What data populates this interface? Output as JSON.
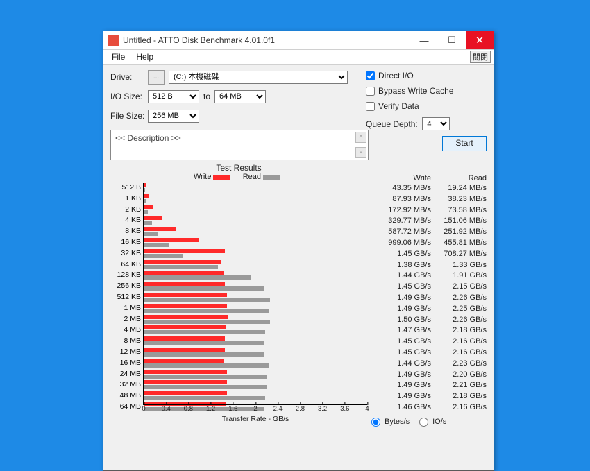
{
  "title": "Untitled - ATTO Disk Benchmark 4.01.0f1",
  "menu": {
    "file": "File",
    "help": "Help",
    "close_jp": "關閉"
  },
  "labels": {
    "drive": "Drive:",
    "iosize": "I/O Size:",
    "filesize": "File Size:",
    "to": "to",
    "testres": "Test Results",
    "write": "Write",
    "read": "Read",
    "xlabel": "Transfer Rate - GB/s",
    "desc": "<< Description >>",
    "dio": "Direct I/O",
    "bwc": "Bypass Write Cache",
    "vd": "Verify Data",
    "qd": "Queue Depth:",
    "start": "Start",
    "bytes": "Bytes/s",
    "ios": "IO/s",
    "browse": "..."
  },
  "values": {
    "drive": "(C:) 本機磁碟",
    "io_from": "512 B",
    "io_to": "64 MB",
    "filesize": "256 MB",
    "qd": "4"
  },
  "checkboxes": {
    "dio": true,
    "bwc": false,
    "vd": false
  },
  "radio": "bytes",
  "axis": {
    "max": 4,
    "ticks": [
      "0",
      "0.4",
      "0.8",
      "1.2",
      "1.6",
      "2",
      "2.4",
      "2.8",
      "3.2",
      "3.6",
      "4"
    ]
  },
  "chart_data": {
    "type": "bar",
    "orientation": "horizontal",
    "title": "Test Results",
    "xlabel": "Transfer Rate - GB/s",
    "xlim": [
      0,
      4
    ],
    "xticks": [
      0,
      0.4,
      0.8,
      1.2,
      1.6,
      2,
      2.4,
      2.8,
      3.2,
      3.6,
      4
    ],
    "categories": [
      "512 B",
      "1 KB",
      "2 KB",
      "4 KB",
      "8 KB",
      "16 KB",
      "32 KB",
      "64 KB",
      "128 KB",
      "256 KB",
      "512 KB",
      "1 MB",
      "2 MB",
      "4 MB",
      "8 MB",
      "12 MB",
      "16 MB",
      "24 MB",
      "32 MB",
      "48 MB",
      "64 MB"
    ],
    "series": [
      {
        "name": "Write",
        "color": "#ff2a2a",
        "values": [
          0.04335,
          0.08793,
          0.17292,
          0.32977,
          0.58772,
          0.99906,
          1.45,
          1.38,
          1.44,
          1.45,
          1.49,
          1.49,
          1.5,
          1.47,
          1.45,
          1.45,
          1.44,
          1.49,
          1.49,
          1.49,
          1.46
        ]
      },
      {
        "name": "Read",
        "color": "#9a9a9a",
        "values": [
          0.01924,
          0.03823,
          0.07358,
          0.15106,
          0.25192,
          0.45581,
          0.70827,
          1.33,
          1.91,
          2.15,
          2.26,
          2.25,
          2.26,
          2.18,
          2.16,
          2.16,
          2.23,
          2.2,
          2.21,
          2.18,
          2.16
        ]
      }
    ]
  },
  "rows": [
    {
      "label": "512 B",
      "w_gb": 0.04335,
      "r_gb": 0.01924,
      "w": "43.35 MB/s",
      "r": "19.24 MB/s"
    },
    {
      "label": "1 KB",
      "w_gb": 0.08793,
      "r_gb": 0.03823,
      "w": "87.93 MB/s",
      "r": "38.23 MB/s"
    },
    {
      "label": "2 KB",
      "w_gb": 0.17292,
      "r_gb": 0.07358,
      "w": "172.92 MB/s",
      "r": "73.58 MB/s"
    },
    {
      "label": "4 KB",
      "w_gb": 0.32977,
      "r_gb": 0.15106,
      "w": "329.77 MB/s",
      "r": "151.06 MB/s"
    },
    {
      "label": "8 KB",
      "w_gb": 0.58772,
      "r_gb": 0.25192,
      "w": "587.72 MB/s",
      "r": "251.92 MB/s"
    },
    {
      "label": "16 KB",
      "w_gb": 0.99906,
      "r_gb": 0.45581,
      "w": "999.06 MB/s",
      "r": "455.81 MB/s"
    },
    {
      "label": "32 KB",
      "w_gb": 1.45,
      "r_gb": 0.70827,
      "w": "1.45 GB/s",
      "r": "708.27 MB/s"
    },
    {
      "label": "64 KB",
      "w_gb": 1.38,
      "r_gb": 1.33,
      "w": "1.38 GB/s",
      "r": "1.33 GB/s"
    },
    {
      "label": "128 KB",
      "w_gb": 1.44,
      "r_gb": 1.91,
      "w": "1.44 GB/s",
      "r": "1.91 GB/s"
    },
    {
      "label": "256 KB",
      "w_gb": 1.45,
      "r_gb": 2.15,
      "w": "1.45 GB/s",
      "r": "2.15 GB/s"
    },
    {
      "label": "512 KB",
      "w_gb": 1.49,
      "r_gb": 2.26,
      "w": "1.49 GB/s",
      "r": "2.26 GB/s"
    },
    {
      "label": "1 MB",
      "w_gb": 1.49,
      "r_gb": 2.25,
      "w": "1.49 GB/s",
      "r": "2.25 GB/s"
    },
    {
      "label": "2 MB",
      "w_gb": 1.5,
      "r_gb": 2.26,
      "w": "1.50 GB/s",
      "r": "2.26 GB/s"
    },
    {
      "label": "4 MB",
      "w_gb": 1.47,
      "r_gb": 2.18,
      "w": "1.47 GB/s",
      "r": "2.18 GB/s"
    },
    {
      "label": "8 MB",
      "w_gb": 1.45,
      "r_gb": 2.16,
      "w": "1.45 GB/s",
      "r": "2.16 GB/s"
    },
    {
      "label": "12 MB",
      "w_gb": 1.45,
      "r_gb": 2.16,
      "w": "1.45 GB/s",
      "r": "2.16 GB/s"
    },
    {
      "label": "16 MB",
      "w_gb": 1.44,
      "r_gb": 2.23,
      "w": "1.44 GB/s",
      "r": "2.23 GB/s"
    },
    {
      "label": "24 MB",
      "w_gb": 1.49,
      "r_gb": 2.2,
      "w": "1.49 GB/s",
      "r": "2.20 GB/s"
    },
    {
      "label": "32 MB",
      "w_gb": 1.49,
      "r_gb": 2.21,
      "w": "1.49 GB/s",
      "r": "2.21 GB/s"
    },
    {
      "label": "48 MB",
      "w_gb": 1.49,
      "r_gb": 2.18,
      "w": "1.49 GB/s",
      "r": "2.18 GB/s"
    },
    {
      "label": "64 MB",
      "w_gb": 1.46,
      "r_gb": 2.16,
      "w": "1.46 GB/s",
      "r": "2.16 GB/s"
    }
  ]
}
